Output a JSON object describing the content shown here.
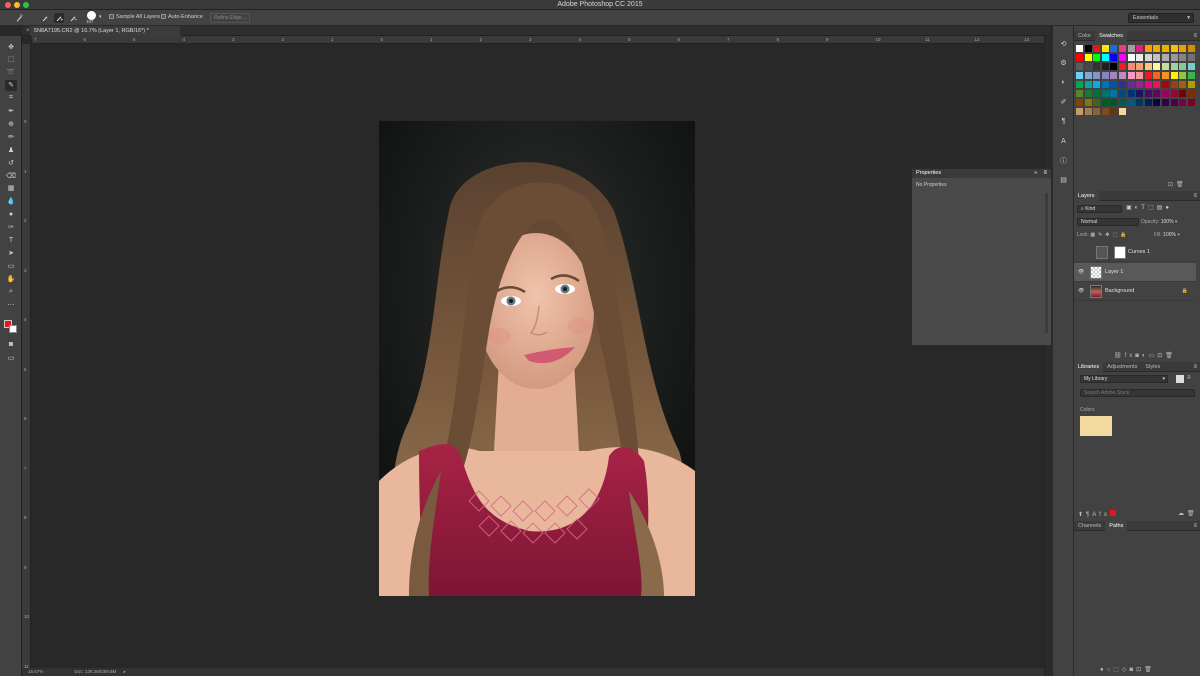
{
  "app": {
    "title": "Adobe Photoshop CC 2015",
    "workspace": "Essentials"
  },
  "options_bar": {
    "brush_size": "107",
    "sample_all_layers": "Sample All Layers",
    "auto_enhance": "Auto-Enhance",
    "refine_edge": "Refine Edge..."
  },
  "document": {
    "tab_label": "5N8A7195.CR2 @ 16.7% (Layer 1, RGB/16*) *",
    "zoom": "16.67%",
    "doc_info": "Doc: 138.2M/259.8M"
  },
  "rulers": {
    "h": [
      "7",
      "6",
      "5",
      "4",
      "3",
      "2",
      "1",
      "0",
      "1",
      "2",
      "3",
      "4",
      "5",
      "6",
      "7",
      "8",
      "9",
      "10",
      "11",
      "12",
      "13"
    ],
    "v": [
      "0",
      "1",
      "2",
      "3",
      "4",
      "5",
      "6",
      "7",
      "8",
      "9",
      "10",
      "11"
    ]
  },
  "colors": {
    "foreground": "#e8141e",
    "background": "#ffffff",
    "accent_swatch": "#f2d9a0"
  },
  "properties": {
    "title": "Properties",
    "body": "No Properties"
  },
  "color_panel": {
    "tabs": [
      "Color",
      "Swatches"
    ],
    "active": "Swatches"
  },
  "layers_panel": {
    "title": "Layers",
    "filter": "Kind",
    "blend_mode": "Normal",
    "opacity_label": "Opacity:",
    "opacity": "100%",
    "lock_label": "Lock:",
    "fill_label": "Fill:",
    "fill": "100%",
    "layers": [
      {
        "name": "Curves 1",
        "type": "adjustment",
        "visible": false,
        "selected": false
      },
      {
        "name": "Layer 1",
        "type": "pixel",
        "visible": true,
        "selected": true
      },
      {
        "name": "Background",
        "type": "background",
        "visible": true,
        "selected": false,
        "locked": true
      }
    ]
  },
  "libraries_panel": {
    "tabs": [
      "Libraries",
      "Adjustments",
      "Styles"
    ],
    "library": "My Library",
    "search_placeholder": "Search Adobe Stock",
    "section": "Colors"
  },
  "bottom_panel": {
    "tabs": [
      "Channels",
      "Paths"
    ],
    "active": "Paths"
  }
}
